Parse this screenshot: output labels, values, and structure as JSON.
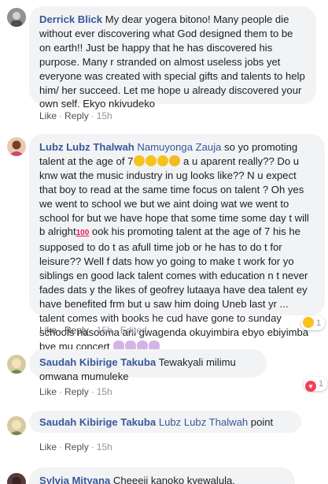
{
  "comments": [
    {
      "author": "Derrick Blick",
      "text": "My dear yogera bitono! Many people die without ever discovering what God designed them to be on earth!! Just be happy that he has discovered his purpose. Many r stranded on almost useless jobs yet everyone was created with special gifts and talents to help him/ her succeed. Let me hope u already discovered your own self. Ekyo nkivudeko",
      "like_label": "Like",
      "reply_label": "Reply",
      "time": "15h"
    },
    {
      "author": "Lubz Lubz Thalwah",
      "mention": "Namuyonga Zauja",
      "text_part1": "so yo promoting talent at the age of 7",
      "text_part2": "a u aparent really?? Do u knw wat the music industry in ug looks like?? N u expect that boy to read at the same time focus on talent ? Oh yes we went to school we but we aint doing wat we went to school for but we have hope that some time some day t will b alright",
      "text_part3": "ook his promoting talent at the age of 7 his he supposed to do t as afull time job or he has to do t for leisure?? Well f dats how yo going to make t work for yo siblings en good lack talent comes with education n t never fades dats y the likes of geofrey lutaaya have dea talent ey have benefited frm but u saw him doing Uneb last yr ... talent comes with books he cud have gone to sunday schools nasooma ani gwagenda okuyimbira ebyo ebiyimba bye mu concert",
      "emoji_hundred": "100",
      "like_label": "Like",
      "reply_label": "Reply",
      "time": "15h",
      "edited_label": "Edited",
      "reaction_count": "1",
      "reaction_type": "haha"
    },
    {
      "author": "Saudah Kibirige Takuba",
      "text": "Tewakyali milimu omwana mumuleke",
      "like_label": "Like",
      "reply_label": "Reply",
      "time": "15h",
      "reaction_count": "1",
      "reaction_type": "love"
    },
    {
      "author": "Saudah Kibirige Takuba",
      "mention": "Lubz Lubz Thalwah",
      "text": "point",
      "like_label": "Like",
      "reply_label": "Reply",
      "time": "15h"
    },
    {
      "author": "Sylvia Mityana",
      "text": "Cheeeii kanoko kyewalula, olugezigezi lukari mumutwe"
    }
  ],
  "colors": {
    "link": "#385898",
    "bubble": "#f2f3f5",
    "meta": "#90949c",
    "love": "#f33e58",
    "haha": "#f7c21b"
  }
}
